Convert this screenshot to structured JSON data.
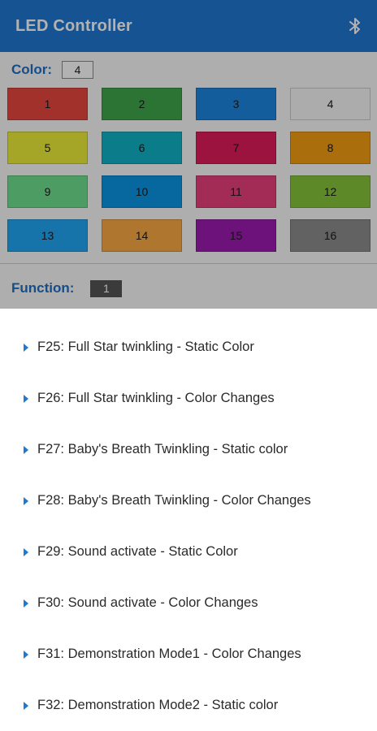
{
  "appbar": {
    "title": "LED Controller",
    "bluetooth_icon": "bluetooth-icon"
  },
  "color_section": {
    "label": "Color:",
    "value": "4",
    "swatches": [
      {
        "label": "1",
        "color": "#e8473f"
      },
      {
        "label": "2",
        "color": "#3fa64a"
      },
      {
        "label": "3",
        "color": "#1d86e0"
      },
      {
        "label": "4",
        "color": "#f7f7f7"
      },
      {
        "label": "5",
        "color": "#ecec3a"
      },
      {
        "label": "6",
        "color": "#10b2c4"
      },
      {
        "label": "7",
        "color": "#de1c59"
      },
      {
        "label": "8",
        "color": "#f59e12"
      },
      {
        "label": "9",
        "color": "#6ee08f"
      },
      {
        "label": "10",
        "color": "#0a96e3"
      },
      {
        "label": "11",
        "color": "#ea3f7c"
      },
      {
        "label": "12",
        "color": "#86c43c"
      },
      {
        "label": "13",
        "color": "#21a6f4"
      },
      {
        "label": "14",
        "color": "#f9a943"
      },
      {
        "label": "15",
        "color": "#9e1ab0"
      },
      {
        "label": "16",
        "color": "#8d8d8d"
      }
    ]
  },
  "function_section": {
    "label": "Function:",
    "value": "1"
  },
  "function_sheet": {
    "items": [
      "F25: Full Star twinkling - Static Color",
      "F26: Full Star twinkling - Color Changes",
      "F27: Baby's Breath Twinkling - Static color",
      "F28: Baby's Breath Twinkling -  Color Changes",
      "F29: Sound activate - Static Color",
      "F30: Sound activate - Color Changes",
      "F31: Demonstration Mode1 -  Color Changes",
      "F32: Demonstration Mode2 - Static color"
    ]
  },
  "colors": {
    "primary": "#1f78d1",
    "section_label": "#1f6fc4",
    "function_value_bg": "#555555"
  }
}
